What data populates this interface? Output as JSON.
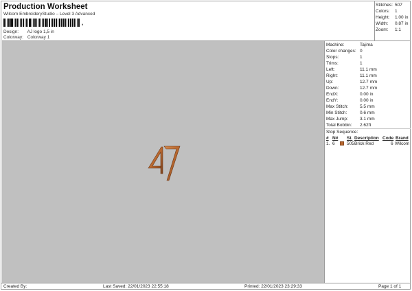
{
  "header": {
    "title": "Production Worksheet",
    "subtitle": "Wilcom EmbroideryStudio – Level 3 Advanced",
    "barcode_suffix": ",",
    "design_label": "Design:",
    "design_value": "AJ logo 1,5 in",
    "colorway_label": "Colorway:",
    "colorway_value": "Colorway 1"
  },
  "summary": {
    "stitches_label": "Stitches:",
    "stitches_value": "507",
    "colors_label": "Colors:",
    "colors_value": "1",
    "height_label": "Height:",
    "height_value": "1.00 in",
    "width_label": "Width:",
    "width_value": "0.87 in",
    "zoom_label": "Zoom:",
    "zoom_value": "1:1"
  },
  "details": [
    {
      "label": "Machine:",
      "value": "Tajima"
    },
    {
      "label": "Color changes:",
      "value": "0"
    },
    {
      "label": "Stops:",
      "value": "1"
    },
    {
      "label": "Trims:",
      "value": "1"
    },
    {
      "label": "Left:",
      "value": "11.1 mm"
    },
    {
      "label": "Right:",
      "value": "11.1 mm"
    },
    {
      "label": "Up:",
      "value": "12.7 mm"
    },
    {
      "label": "Down:",
      "value": "12.7 mm"
    },
    {
      "label": "EndX:",
      "value": "0.00 in"
    },
    {
      "label": "EndY:",
      "value": "0.00 in"
    },
    {
      "label": "Max Stitch:",
      "value": "5.5 mm"
    },
    {
      "label": "Min Stitch:",
      "value": "0.6 mm"
    },
    {
      "label": "Max Jump:",
      "value": "3.1 mm"
    },
    {
      "label": "Total Bobbin:",
      "value": "2.62ft"
    }
  ],
  "stop_sequence": {
    "title": "Stop Sequence:",
    "headers": {
      "num": "#",
      "n": "N#",
      "st": "St.",
      "desc": "Description",
      "code": "Code",
      "brand": "Brand"
    },
    "rows": [
      {
        "num": "1.",
        "n": "6",
        "st": "505",
        "desc": "Brick Red",
        "code": "6",
        "brand": "Wilcom",
        "color": "#b7672f"
      }
    ]
  },
  "footer": {
    "created_by": "Created By:",
    "last_saved": "Last Saved: 22/01/2023 22:55:18",
    "printed": "Printed: 22/01/2023 23:29:33",
    "page": "Page 1 of 1"
  },
  "colors": {
    "canvas": "#c0c0c0",
    "thread": "#b7672f",
    "border": "#9a9a9a"
  }
}
